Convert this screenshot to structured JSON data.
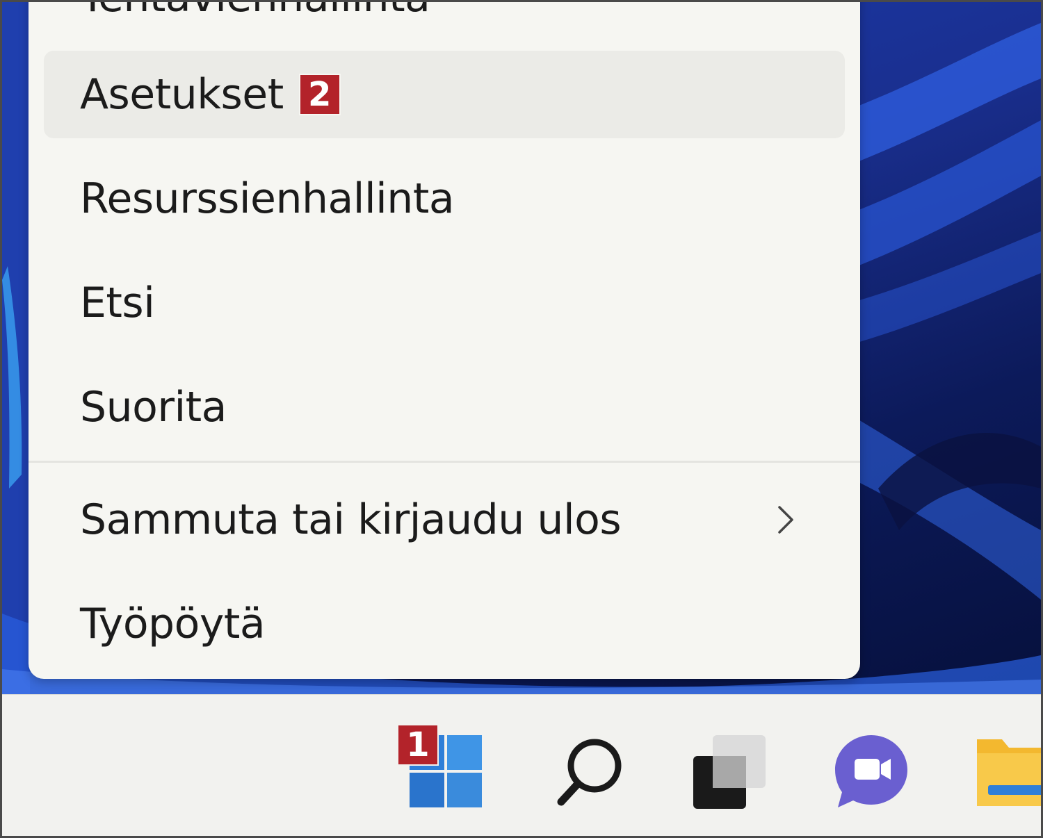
{
  "menu": {
    "items": [
      {
        "label": "Tehtävienhallinta"
      },
      {
        "label": "Asetukset",
        "badge": "2"
      },
      {
        "label": "Resurssienhallinta"
      },
      {
        "label": "Etsi"
      },
      {
        "label": "Suorita"
      },
      {
        "label": "Sammuta tai kirjaudu ulos",
        "submenu_icon": "chevron-right-icon"
      },
      {
        "label": "Työpöytä"
      }
    ]
  },
  "taskbar": {
    "start_badge": "1",
    "icons": [
      "windows-start-icon",
      "search-icon",
      "task-view-icon",
      "teams-chat-icon",
      "file-explorer-icon"
    ]
  },
  "colors": {
    "badge": "#b3232a",
    "menu_background": "#f6f6f2",
    "hover_background": "#ebebe7",
    "taskbar_background": "#f2f2ef",
    "wallpaper": "#1a2f8f"
  }
}
